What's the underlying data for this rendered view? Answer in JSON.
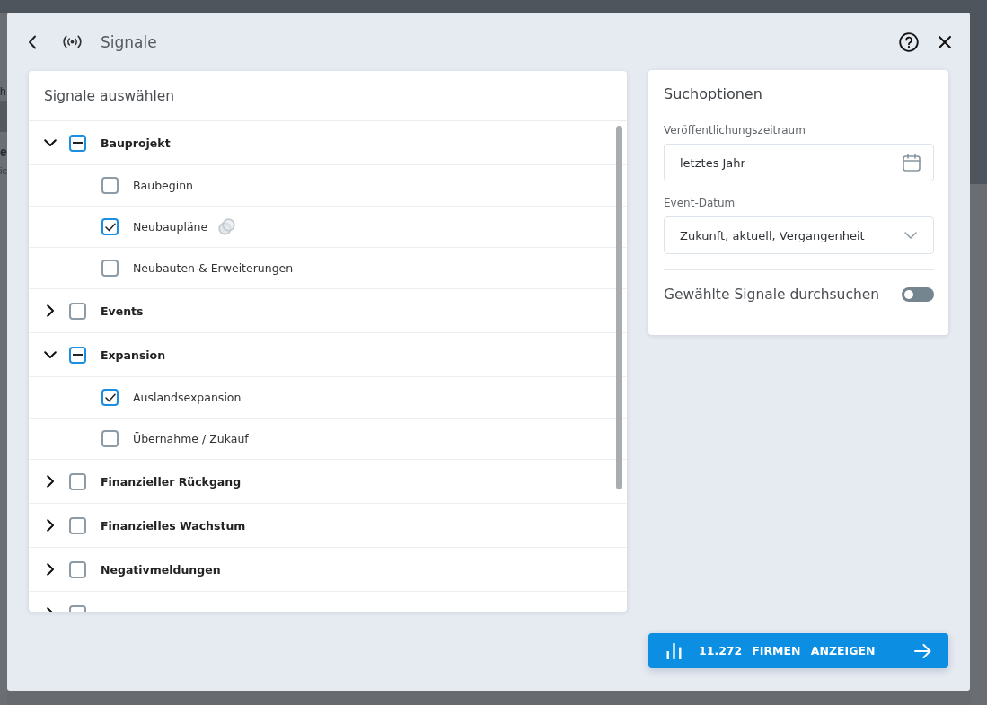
{
  "window": {
    "title": "Signale"
  },
  "backdrop": {
    "texts": [
      "h",
      "e",
      "ic"
    ]
  },
  "signals_panel": {
    "title": "Signale auswählen",
    "groups": [
      {
        "label": "Bauprojekt",
        "expanded": true,
        "checked": false,
        "indeterminate": true,
        "children": [
          {
            "label": "Baubeginn",
            "checked": false,
            "linked": false
          },
          {
            "label": "Neubaupläne",
            "checked": true,
            "linked": true
          },
          {
            "label": "Neubauten & Erweiterungen",
            "checked": false,
            "linked": false
          }
        ]
      },
      {
        "label": "Events",
        "expanded": false,
        "checked": false,
        "indeterminate": false
      },
      {
        "label": "Expansion",
        "expanded": true,
        "checked": false,
        "indeterminate": true,
        "children": [
          {
            "label": "Auslandsexpansion",
            "checked": true,
            "linked": false
          },
          {
            "label": "Übernahme / Zukauf",
            "checked": false,
            "linked": false
          }
        ]
      },
      {
        "label": "Finanzieller Rückgang",
        "expanded": false,
        "checked": false,
        "indeterminate": false
      },
      {
        "label": "Finanzielles Wachstum",
        "expanded": false,
        "checked": false,
        "indeterminate": false
      },
      {
        "label": "Negativmeldungen",
        "expanded": false,
        "checked": false,
        "indeterminate": false
      },
      {
        "expanded": false,
        "checked": false,
        "indeterminate": false
      }
    ]
  },
  "search_options": {
    "title": "Suchoptionen",
    "fields": [
      {
        "kind": "date",
        "label": "Veröffentlichungszeitraum",
        "value": "letztes Jahr"
      },
      {
        "kind": "select",
        "label": "Event-Datum",
        "value": "Zukunft, aktuell, Vergangenheit"
      }
    ],
    "toggle": {
      "label": "Gewählte Signale durchsuchen",
      "on": false
    }
  },
  "show_button": {
    "count": "11.272",
    "label": "FIRMEN ANZEIGEN"
  }
}
